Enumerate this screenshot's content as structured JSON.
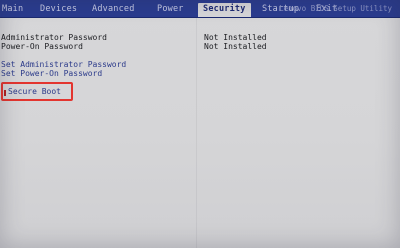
{
  "menu": {
    "tabs": [
      {
        "label": "Main"
      },
      {
        "label": "Devices"
      },
      {
        "label": "Advanced"
      },
      {
        "label": "Power"
      },
      {
        "label": "Security"
      },
      {
        "label": "Startup"
      },
      {
        "label": "Exit"
      }
    ],
    "active_tab": "Security",
    "brand": "Lenovo BIOS Setup Utility"
  },
  "security": {
    "admin_password": {
      "label": "Administrator Password",
      "value": "Not Installed"
    },
    "poweron_password": {
      "label": "Power-On Password",
      "value": "Not Installed"
    },
    "set_admin_password": "Set Administrator Password",
    "set_poweron_password": "Set Power-On Password",
    "secure_boot": "Secure Boot"
  },
  "colors": {
    "menubar": "#2a3c8f",
    "screen": "#d7d7d9",
    "highlight_border": "#e3352f",
    "link_text": "#2b3a8a"
  }
}
